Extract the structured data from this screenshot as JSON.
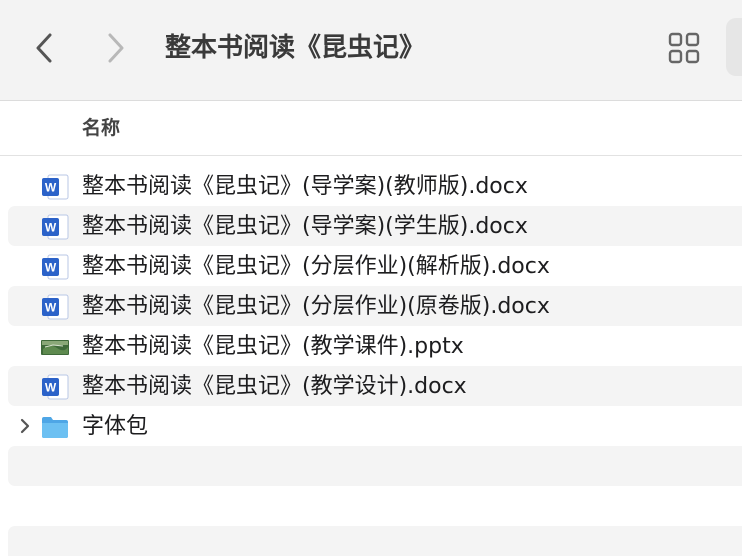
{
  "toolbar": {
    "back_icon": "chevron-left-icon",
    "forward_icon": "chevron-right-icon",
    "title": "整本书阅读《昆虫记》",
    "view_icon": "grid-view-icon"
  },
  "columns": {
    "name": "名称"
  },
  "files": [
    {
      "name": "整本书阅读《昆虫记》(导学案)(教师版).docx",
      "kind": "word-doc-icon"
    },
    {
      "name": "整本书阅读《昆虫记》(导学案)(学生版).docx",
      "kind": "word-doc-icon"
    },
    {
      "name": "整本书阅读《昆虫记》(分层作业)(解析版).docx",
      "kind": "word-doc-icon"
    },
    {
      "name": "整本书阅读《昆虫记》(分层作业)(原卷版).docx",
      "kind": "word-doc-icon"
    },
    {
      "name": "整本书阅读《昆虫记》(教学课件).pptx",
      "kind": "pptx-thumbnail-icon"
    },
    {
      "name": "整本书阅读《昆虫记》(教学设计).docx",
      "kind": "word-doc-icon"
    },
    {
      "name": "字体包",
      "kind": "folder-icon"
    }
  ],
  "colors": {
    "word_blue": "#2b62c9",
    "folder_blue": "#5ab0ec",
    "row_alt": "#f4f4f4"
  }
}
